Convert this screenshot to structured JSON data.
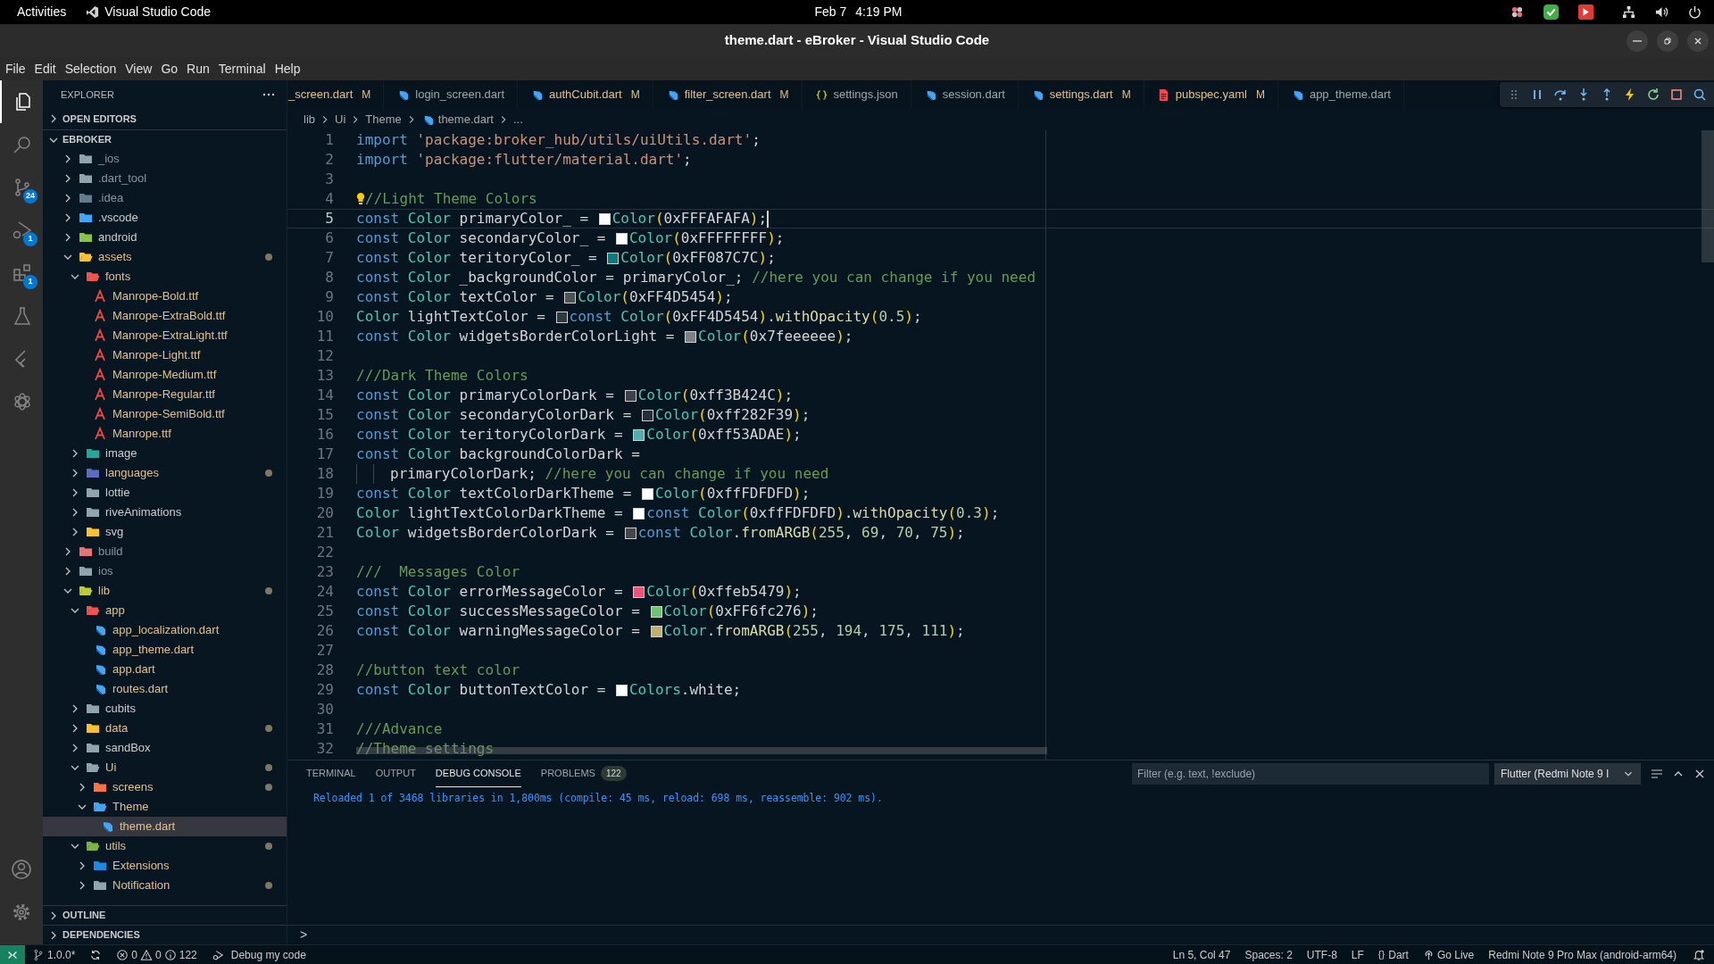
{
  "top_bar": {
    "activities": "Activities",
    "app": "Visual Studio Code",
    "date": "Feb 7",
    "time": "4:19 PM"
  },
  "window": {
    "title": "theme.dart - eBroker - Visual Studio Code"
  },
  "menu": [
    "File",
    "Edit",
    "Selection",
    "View",
    "Go",
    "Run",
    "Terminal",
    "Help"
  ],
  "activity_bar": [
    {
      "kind": "files",
      "selected": true
    },
    {
      "kind": "search",
      "selected": false
    },
    {
      "kind": "source-control",
      "badge": "24",
      "selected": false
    },
    {
      "kind": "run-debug",
      "badge": "1",
      "selected": false
    },
    {
      "kind": "extensions",
      "badge": "1",
      "selected": false
    },
    {
      "kind": "testing",
      "selected": false
    },
    {
      "kind": "flutter",
      "selected": false
    },
    {
      "kind": "knot",
      "selected": false
    }
  ],
  "sidebar": {
    "title": "EXPLORER",
    "sections": [
      {
        "label": "OPEN EDITORS",
        "expanded": false
      },
      {
        "label": "EBROKER",
        "expanded": true,
        "tree": [
          {
            "name": "_ios",
            "kind": "folder",
            "color": "#90a4ae",
            "expanded": false,
            "modified": false,
            "ignored": true,
            "dot": false,
            "selected": false
          },
          {
            "name": ".dart_tool",
            "kind": "folder",
            "color": "#90a4ae",
            "expanded": false,
            "modified": false,
            "ignored": true,
            "dot": false,
            "selected": false
          },
          {
            "name": ".idea",
            "kind": "folder",
            "color": "#607d8b",
            "expanded": false,
            "modified": false,
            "ignored": true,
            "dot": false,
            "selected": false
          },
          {
            "name": ".vscode",
            "kind": "folder",
            "color": "#42a5f5",
            "expanded": false,
            "modified": false,
            "ignored": false,
            "dot": false,
            "selected": false
          },
          {
            "name": "android",
            "kind": "folder",
            "color": "#8bc34a",
            "expanded": false,
            "modified": false,
            "ignored": false,
            "dot": false,
            "selected": false
          },
          {
            "name": "assets",
            "kind": "folder",
            "color": "#fbc02d",
            "expanded": true,
            "modified": true,
            "ignored": false,
            "dot": true,
            "selected": false,
            "children": [
              {
                "name": "fonts",
                "kind": "folder",
                "color": "#ef5350",
                "expanded": true,
                "modified": true,
                "ignored": false,
                "dot": false,
                "selected": false,
                "children": [
                  {
                    "name": "Manrope-Bold.ttf",
                    "kind": "font",
                    "modified": true,
                    "ignored": false,
                    "dot": false,
                    "selected": false
                  },
                  {
                    "name": "Manrope-ExtraBold.ttf",
                    "kind": "font",
                    "modified": true,
                    "ignored": false,
                    "dot": false,
                    "selected": false
                  },
                  {
                    "name": "Manrope-ExtraLight.ttf",
                    "kind": "font",
                    "modified": true,
                    "ignored": false,
                    "dot": false,
                    "selected": false
                  },
                  {
                    "name": "Manrope-Light.ttf",
                    "kind": "font",
                    "modified": true,
                    "ignored": false,
                    "dot": false,
                    "selected": false
                  },
                  {
                    "name": "Manrope-Medium.ttf",
                    "kind": "font",
                    "modified": true,
                    "ignored": false,
                    "dot": false,
                    "selected": false
                  },
                  {
                    "name": "Manrope-Regular.ttf",
                    "kind": "font",
                    "modified": true,
                    "ignored": false,
                    "dot": false,
                    "selected": false
                  },
                  {
                    "name": "Manrope-SemiBold.ttf",
                    "kind": "font",
                    "modified": true,
                    "ignored": false,
                    "dot": false,
                    "selected": false
                  },
                  {
                    "name": "Manrope.ttf",
                    "kind": "font",
                    "modified": true,
                    "ignored": false,
                    "dot": false,
                    "selected": false
                  }
                ]
              },
              {
                "name": "image",
                "kind": "folder",
                "color": "#26a69a",
                "expanded": false,
                "modified": false,
                "ignored": false,
                "dot": false,
                "selected": false
              },
              {
                "name": "languages",
                "kind": "folder",
                "color": "#5c6bc0",
                "expanded": false,
                "modified": true,
                "ignored": false,
                "dot": true,
                "selected": false
              },
              {
                "name": "lottie",
                "kind": "folder",
                "color": "#90a4ae",
                "expanded": false,
                "modified": false,
                "ignored": false,
                "dot": false,
                "selected": false
              },
              {
                "name": "riveAnimations",
                "kind": "folder",
                "color": "#90a4ae",
                "expanded": false,
                "modified": false,
                "ignored": false,
                "dot": false,
                "selected": false
              },
              {
                "name": "svg",
                "kind": "folder",
                "color": "#fbc02d",
                "expanded": false,
                "modified": false,
                "ignored": false,
                "dot": false,
                "selected": false
              }
            ]
          },
          {
            "name": "build",
            "kind": "folder",
            "color": "#e57373",
            "expanded": false,
            "modified": false,
            "ignored": true,
            "dot": false,
            "selected": false
          },
          {
            "name": "ios",
            "kind": "folder",
            "color": "#90a4ae",
            "expanded": false,
            "modified": false,
            "ignored": true,
            "dot": false,
            "selected": false
          },
          {
            "name": "lib",
            "kind": "folder",
            "color": "#c0ca33",
            "expanded": true,
            "modified": true,
            "ignored": false,
            "dot": true,
            "selected": false,
            "children": [
              {
                "name": "app",
                "kind": "folder",
                "color": "#ef5350",
                "expanded": true,
                "modified": true,
                "ignored": false,
                "dot": false,
                "selected": false,
                "children": [
                  {
                    "name": "app_localization.dart",
                    "kind": "dart",
                    "modified": true,
                    "ignored": false,
                    "dot": false,
                    "selected": false
                  },
                  {
                    "name": "app_theme.dart",
                    "kind": "dart",
                    "modified": true,
                    "ignored": false,
                    "dot": false,
                    "selected": false
                  },
                  {
                    "name": "app.dart",
                    "kind": "dart",
                    "modified": true,
                    "ignored": false,
                    "dot": false,
                    "selected": false
                  },
                  {
                    "name": "routes.dart",
                    "kind": "dart",
                    "modified": true,
                    "ignored": false,
                    "dot": false,
                    "selected": false
                  }
                ]
              },
              {
                "name": "cubits",
                "kind": "folder",
                "color": "#90a4ae",
                "expanded": false,
                "modified": false,
                "ignored": false,
                "dot": false,
                "selected": false
              },
              {
                "name": "data",
                "kind": "folder",
                "color": "#fbc02d",
                "expanded": false,
                "modified": true,
                "ignored": false,
                "dot": true,
                "selected": false
              },
              {
                "name": "sandBox",
                "kind": "folder",
                "color": "#90a4ae",
                "expanded": false,
                "modified": false,
                "ignored": false,
                "dot": false,
                "selected": false
              },
              {
                "name": "Ui",
                "kind": "folder",
                "color": "#90a4ae",
                "expanded": true,
                "modified": true,
                "ignored": false,
                "dot": true,
                "selected": false,
                "children": [
                  {
                    "name": "screens",
                    "kind": "folder",
                    "color": "#ff7043",
                    "expanded": false,
                    "modified": true,
                    "ignored": false,
                    "dot": true,
                    "selected": false
                  },
                  {
                    "name": "Theme",
                    "kind": "folder",
                    "color": "#42a5f5",
                    "expanded": true,
                    "modified": true,
                    "ignored": false,
                    "dot": false,
                    "selected": false,
                    "children": [
                      {
                        "name": "theme.dart",
                        "kind": "dart",
                        "modified": true,
                        "ignored": false,
                        "dot": false,
                        "selected": true
                      }
                    ]
                  }
                ]
              },
              {
                "name": "utils",
                "kind": "folder",
                "color": "#7cb342",
                "expanded": true,
                "modified": true,
                "ignored": false,
                "dot": true,
                "selected": false,
                "children": [
                  {
                    "name": "Extensions",
                    "kind": "folder",
                    "color": "#1e88e5",
                    "expanded": false,
                    "modified": true,
                    "ignored": false,
                    "dot": false,
                    "selected": false
                  },
                  {
                    "name": "Notification",
                    "kind": "folder",
                    "color": "#90a4ae",
                    "expanded": false,
                    "modified": true,
                    "ignored": false,
                    "dot": true,
                    "selected": false
                  }
                ]
              }
            ]
          }
        ]
      },
      {
        "label": "OUTLINE",
        "expanded": false
      },
      {
        "label": "DEPENDENCIES",
        "expanded": false
      }
    ]
  },
  "tabs": [
    {
      "label": "_screen.dart",
      "badge": "M",
      "selected": false
    },
    {
      "label": "login_screen.dart",
      "kind": "dart",
      "selected": false
    },
    {
      "label": "authCubit.dart",
      "kind": "dart",
      "badge": "M",
      "selected": false
    },
    {
      "label": "filter_screen.dart",
      "kind": "dart",
      "badge": "M",
      "selected": false
    },
    {
      "label": "settings.json",
      "kind": "json",
      "selected": false
    },
    {
      "label": "session.dart",
      "kind": "dart",
      "selected": false
    },
    {
      "label": "settings.dart",
      "kind": "dart",
      "badge": "M",
      "selected": false
    },
    {
      "label": "pubspec.yaml",
      "kind": "yaml",
      "badge": "M",
      "selected": false
    },
    {
      "label": "app_theme.dart",
      "kind": "dart",
      "selected": false
    }
  ],
  "breadcrumbs": [
    {
      "kind": "folder",
      "text": "lib"
    },
    {
      "kind": "folder",
      "text": "Ui"
    },
    {
      "kind": "folder",
      "text": "Theme"
    },
    {
      "kind": "dart",
      "text": "theme.dart"
    },
    {
      "kind": "more",
      "text": "..."
    }
  ],
  "editor": {
    "lines": [
      {
        "number": "1",
        "current": false,
        "lightbulb": false,
        "continuation": false,
        "tokens": [
          {
            "kind": "keyword",
            "text": "import "
          },
          {
            "kind": "string",
            "text": "'package:broker_hub/utils/uiUtils.dart'"
          },
          {
            "kind": "punct",
            "text": ";"
          }
        ]
      },
      {
        "number": "2",
        "current": false,
        "lightbulb": false,
        "continuation": false,
        "tokens": [
          {
            "kind": "keyword",
            "text": "import "
          },
          {
            "kind": "string",
            "text": "'package:flutter/material.dart'"
          },
          {
            "kind": "punct",
            "text": ";"
          }
        ]
      },
      {
        "number": "3",
        "current": false,
        "lightbulb": false,
        "continuation": false
      },
      {
        "number": "4",
        "current": false,
        "lightbulb": true,
        "continuation": false,
        "tokens": [
          {
            "kind": "comment",
            "text": "//Light Theme Colors"
          }
        ]
      },
      {
        "number": "5",
        "current": true,
        "lightbulb": false,
        "continuation": false,
        "tokens": [
          {
            "kind": "keyword",
            "text": "const "
          },
          {
            "kind": "type",
            "text": "Color "
          },
          {
            "kind": "name",
            "text": "primaryColor_ "
          },
          {
            "kind": "punct",
            "text": "= "
          },
          {
            "kind": "swatch",
            "color": "#fafafa"
          },
          {
            "kind": "type",
            "text": "Color"
          },
          {
            "kind": "bracket",
            "text": "("
          },
          {
            "kind": "name",
            "text": "0xFFFAFAFA"
          },
          {
            "kind": "bracket",
            "text": ")"
          },
          {
            "kind": "punct",
            "text": ";"
          }
        ]
      },
      {
        "number": "6",
        "current": false,
        "lightbulb": false,
        "continuation": false,
        "tokens": [
          {
            "kind": "keyword",
            "text": "const "
          },
          {
            "kind": "type",
            "text": "Color "
          },
          {
            "kind": "name",
            "text": "secondaryColor_ "
          },
          {
            "kind": "punct",
            "text": "= "
          },
          {
            "kind": "swatch",
            "color": "#ffffff"
          },
          {
            "kind": "type",
            "text": "Color"
          },
          {
            "kind": "bracket",
            "text": "("
          },
          {
            "kind": "name",
            "text": "0xFFFFFFFF"
          },
          {
            "kind": "bracket",
            "text": ")"
          },
          {
            "kind": "punct",
            "text": ";"
          }
        ]
      },
      {
        "number": "7",
        "current": false,
        "lightbulb": false,
        "continuation": false,
        "tokens": [
          {
            "kind": "keyword",
            "text": "const "
          },
          {
            "kind": "type",
            "text": "Color "
          },
          {
            "kind": "name",
            "text": "teritoryColor_ "
          },
          {
            "kind": "punct",
            "text": "= "
          },
          {
            "kind": "swatch",
            "color": "#087c7c"
          },
          {
            "kind": "type",
            "text": "Color"
          },
          {
            "kind": "bracket",
            "text": "("
          },
          {
            "kind": "name",
            "text": "0xFF087C7C"
          },
          {
            "kind": "bracket",
            "text": ")"
          },
          {
            "kind": "punct",
            "text": ";"
          }
        ]
      },
      {
        "number": "8",
        "current": false,
        "lightbulb": false,
        "continuation": false,
        "tokens": [
          {
            "kind": "keyword",
            "text": "const "
          },
          {
            "kind": "type",
            "text": "Color "
          },
          {
            "kind": "name",
            "text": "_backgroundColor "
          },
          {
            "kind": "punct",
            "text": "= "
          },
          {
            "kind": "name",
            "text": "primaryColor_"
          },
          {
            "kind": "punct",
            "text": "; "
          },
          {
            "kind": "comment",
            "text": "//here you can change if you need"
          }
        ]
      },
      {
        "number": "9",
        "current": false,
        "lightbulb": false,
        "continuation": false,
        "tokens": [
          {
            "kind": "keyword",
            "text": "const "
          },
          {
            "kind": "type",
            "text": "Color "
          },
          {
            "kind": "name",
            "text": "textColor "
          },
          {
            "kind": "punct",
            "text": "= "
          },
          {
            "kind": "swatch",
            "color": "#4d5454"
          },
          {
            "kind": "type",
            "text": "Color"
          },
          {
            "kind": "bracket",
            "text": "("
          },
          {
            "kind": "name",
            "text": "0xFF4D5454"
          },
          {
            "kind": "bracket",
            "text": ")"
          },
          {
            "kind": "punct",
            "text": ";"
          }
        ]
      },
      {
        "number": "10",
        "current": false,
        "lightbulb": false,
        "continuation": false,
        "tokens": [
          {
            "kind": "type",
            "text": "Color "
          },
          {
            "kind": "name",
            "text": "lightTextColor "
          },
          {
            "kind": "punct",
            "text": "= "
          },
          {
            "kind": "swatch",
            "color": "#2e3a3e"
          },
          {
            "kind": "keyword",
            "text": "const "
          },
          {
            "kind": "type",
            "text": "Color"
          },
          {
            "kind": "bracket",
            "text": "("
          },
          {
            "kind": "name",
            "text": "0xFF4D5454"
          },
          {
            "kind": "bracket",
            "text": ")"
          },
          {
            "kind": "punct",
            "text": "."
          },
          {
            "kind": "method",
            "text": "withOpacity"
          },
          {
            "kind": "bracket",
            "text": "("
          },
          {
            "kind": "number",
            "text": "0.5"
          },
          {
            "kind": "bracket",
            "text": ")"
          },
          {
            "kind": "punct",
            "text": ";"
          }
        ]
      },
      {
        "number": "11",
        "current": false,
        "lightbulb": false,
        "continuation": false,
        "tokens": [
          {
            "kind": "keyword",
            "text": "const "
          },
          {
            "kind": "type",
            "text": "Color "
          },
          {
            "kind": "name",
            "text": "widgetsBorderColorLight "
          },
          {
            "kind": "punct",
            "text": "= "
          },
          {
            "kind": "swatch",
            "color": "#7b8185"
          },
          {
            "kind": "type",
            "text": "Color"
          },
          {
            "kind": "bracket",
            "text": "("
          },
          {
            "kind": "name",
            "text": "0x7feeeeee"
          },
          {
            "kind": "bracket",
            "text": ")"
          },
          {
            "kind": "punct",
            "text": ";"
          }
        ]
      },
      {
        "number": "12",
        "current": false,
        "lightbulb": false,
        "continuation": false
      },
      {
        "number": "13",
        "current": false,
        "lightbulb": false,
        "continuation": false,
        "tokens": [
          {
            "kind": "comment",
            "text": "///Dark Theme Colors"
          }
        ]
      },
      {
        "number": "14",
        "current": false,
        "lightbulb": false,
        "continuation": false,
        "tokens": [
          {
            "kind": "keyword",
            "text": "const "
          },
          {
            "kind": "type",
            "text": "Color "
          },
          {
            "kind": "name",
            "text": "primaryColorDark "
          },
          {
            "kind": "punct",
            "text": "= "
          },
          {
            "kind": "swatch",
            "color": "#3b424c"
          },
          {
            "kind": "type",
            "text": "Color"
          },
          {
            "kind": "bracket",
            "text": "("
          },
          {
            "kind": "name",
            "text": "0xff3B424C"
          },
          {
            "kind": "bracket",
            "text": ")"
          },
          {
            "kind": "punct",
            "text": ";"
          }
        ]
      },
      {
        "number": "15",
        "current": false,
        "lightbulb": false,
        "continuation": false,
        "tokens": [
          {
            "kind": "keyword",
            "text": "const "
          },
          {
            "kind": "type",
            "text": "Color "
          },
          {
            "kind": "name",
            "text": "secondaryColorDark "
          },
          {
            "kind": "punct",
            "text": "= "
          },
          {
            "kind": "swatch",
            "color": "#282f39"
          },
          {
            "kind": "type",
            "text": "Color"
          },
          {
            "kind": "bracket",
            "text": "("
          },
          {
            "kind": "name",
            "text": "0xff282F39"
          },
          {
            "kind": "bracket",
            "text": ")"
          },
          {
            "kind": "punct",
            "text": ";"
          }
        ]
      },
      {
        "number": "16",
        "current": false,
        "lightbulb": false,
        "continuation": false,
        "tokens": [
          {
            "kind": "keyword",
            "text": "const "
          },
          {
            "kind": "type",
            "text": "Color "
          },
          {
            "kind": "name",
            "text": "teritoryColorDark "
          },
          {
            "kind": "punct",
            "text": "= "
          },
          {
            "kind": "swatch",
            "color": "#53adae"
          },
          {
            "kind": "type",
            "text": "Color"
          },
          {
            "kind": "bracket",
            "text": "("
          },
          {
            "kind": "name",
            "text": "0xff53ADAE"
          },
          {
            "kind": "bracket",
            "text": ")"
          },
          {
            "kind": "punct",
            "text": ";"
          }
        ]
      },
      {
        "number": "17",
        "current": false,
        "lightbulb": false,
        "continuation": false,
        "tokens": [
          {
            "kind": "keyword",
            "text": "const "
          },
          {
            "kind": "type",
            "text": "Color "
          },
          {
            "kind": "name",
            "text": "backgroundColorDark "
          },
          {
            "kind": "punct",
            "text": "="
          }
        ]
      },
      {
        "number": "18",
        "current": false,
        "lightbulb": false,
        "continuation": true,
        "tokens": [
          {
            "kind": "name",
            "text": "primaryColorDark"
          },
          {
            "kind": "punct",
            "text": "; "
          },
          {
            "kind": "comment",
            "text": "//here you can change if you need"
          }
        ]
      },
      {
        "number": "19",
        "current": false,
        "lightbulb": false,
        "continuation": false,
        "tokens": [
          {
            "kind": "keyword",
            "text": "const "
          },
          {
            "kind": "type",
            "text": "Color "
          },
          {
            "kind": "name",
            "text": "textColorDarkTheme "
          },
          {
            "kind": "punct",
            "text": "= "
          },
          {
            "kind": "swatch",
            "color": "#fdfdfd"
          },
          {
            "kind": "type",
            "text": "Color"
          },
          {
            "kind": "bracket",
            "text": "("
          },
          {
            "kind": "name",
            "text": "0xffFDFDFD"
          },
          {
            "kind": "bracket",
            "text": ")"
          },
          {
            "kind": "punct",
            "text": ";"
          }
        ]
      },
      {
        "number": "20",
        "current": false,
        "lightbulb": false,
        "continuation": false,
        "tokens": [
          {
            "kind": "type",
            "text": "Color "
          },
          {
            "kind": "name",
            "text": "lightTextColorDarkTheme "
          },
          {
            "kind": "punct",
            "text": "= "
          },
          {
            "kind": "swatch",
            "color": "#fdfdfd"
          },
          {
            "kind": "keyword",
            "text": "const "
          },
          {
            "kind": "type",
            "text": "Color"
          },
          {
            "kind": "bracket",
            "text": "("
          },
          {
            "kind": "name",
            "text": "0xffFDFDFD"
          },
          {
            "kind": "bracket",
            "text": ")"
          },
          {
            "kind": "punct",
            "text": "."
          },
          {
            "kind": "method",
            "text": "withOpacity"
          },
          {
            "kind": "bracket",
            "text": "("
          },
          {
            "kind": "number",
            "text": "0.3"
          },
          {
            "kind": "bracket",
            "text": ")"
          },
          {
            "kind": "punct",
            "text": ";"
          }
        ]
      },
      {
        "number": "21",
        "current": false,
        "lightbulb": false,
        "continuation": false,
        "tokens": [
          {
            "kind": "type",
            "text": "Color "
          },
          {
            "kind": "name",
            "text": "widgetsBorderColorDark "
          },
          {
            "kind": "punct",
            "text": "= "
          },
          {
            "kind": "swatch",
            "color": "#45464b"
          },
          {
            "kind": "keyword",
            "text": "const "
          },
          {
            "kind": "type",
            "text": "Color"
          },
          {
            "kind": "punct",
            "text": "."
          },
          {
            "kind": "method",
            "text": "fromARGB"
          },
          {
            "kind": "bracket",
            "text": "("
          },
          {
            "kind": "number",
            "text": "255"
          },
          {
            "kind": "punct",
            "text": ", "
          },
          {
            "kind": "number",
            "text": "69"
          },
          {
            "kind": "punct",
            "text": ", "
          },
          {
            "kind": "number",
            "text": "70"
          },
          {
            "kind": "punct",
            "text": ", "
          },
          {
            "kind": "number",
            "text": "75"
          },
          {
            "kind": "bracket",
            "text": ")"
          },
          {
            "kind": "punct",
            "text": ";"
          }
        ]
      },
      {
        "number": "22",
        "current": false,
        "lightbulb": false,
        "continuation": false
      },
      {
        "number": "23",
        "current": false,
        "lightbulb": false,
        "continuation": false,
        "tokens": [
          {
            "kind": "comment",
            "text": "///  Messages Color"
          }
        ]
      },
      {
        "number": "24",
        "current": false,
        "lightbulb": false,
        "continuation": false,
        "tokens": [
          {
            "kind": "keyword",
            "text": "const "
          },
          {
            "kind": "type",
            "text": "Color "
          },
          {
            "kind": "name",
            "text": "errorMessageColor "
          },
          {
            "kind": "punct",
            "text": "= "
          },
          {
            "kind": "swatch",
            "color": "#eb5479"
          },
          {
            "kind": "type",
            "text": "Color"
          },
          {
            "kind": "bracket",
            "text": "("
          },
          {
            "kind": "name",
            "text": "0xffeb5479"
          },
          {
            "kind": "bracket",
            "text": ")"
          },
          {
            "kind": "punct",
            "text": ";"
          }
        ]
      },
      {
        "number": "25",
        "current": false,
        "lightbulb": false,
        "continuation": false,
        "tokens": [
          {
            "kind": "keyword",
            "text": "const "
          },
          {
            "kind": "type",
            "text": "Color "
          },
          {
            "kind": "name",
            "text": "successMessageColor "
          },
          {
            "kind": "punct",
            "text": "= "
          },
          {
            "kind": "swatch",
            "color": "#6fc276"
          },
          {
            "kind": "type",
            "text": "Color"
          },
          {
            "kind": "bracket",
            "text": "("
          },
          {
            "kind": "name",
            "text": "0xFF6fc276"
          },
          {
            "kind": "bracket",
            "text": ")"
          },
          {
            "kind": "punct",
            "text": ";"
          }
        ]
      },
      {
        "number": "26",
        "current": false,
        "lightbulb": false,
        "continuation": false,
        "tokens": [
          {
            "kind": "keyword",
            "text": "const "
          },
          {
            "kind": "type",
            "text": "Color "
          },
          {
            "kind": "name",
            "text": "warningMessageColor "
          },
          {
            "kind": "punct",
            "text": "= "
          },
          {
            "kind": "swatch",
            "color": "#c2af6f"
          },
          {
            "kind": "type",
            "text": "Color"
          },
          {
            "kind": "punct",
            "text": "."
          },
          {
            "kind": "method",
            "text": "fromARGB"
          },
          {
            "kind": "bracket",
            "text": "("
          },
          {
            "kind": "number",
            "text": "255"
          },
          {
            "kind": "punct",
            "text": ", "
          },
          {
            "kind": "number",
            "text": "194"
          },
          {
            "kind": "punct",
            "text": ", "
          },
          {
            "kind": "number",
            "text": "175"
          },
          {
            "kind": "punct",
            "text": ", "
          },
          {
            "kind": "number",
            "text": "111"
          },
          {
            "kind": "bracket",
            "text": ")"
          },
          {
            "kind": "punct",
            "text": ";"
          }
        ]
      },
      {
        "number": "27",
        "current": false,
        "lightbulb": false,
        "continuation": false
      },
      {
        "number": "28",
        "current": false,
        "lightbulb": false,
        "continuation": false,
        "tokens": [
          {
            "kind": "comment",
            "text": "//button text color"
          }
        ]
      },
      {
        "number": "29",
        "current": false,
        "lightbulb": false,
        "continuation": false,
        "tokens": [
          {
            "kind": "keyword",
            "text": "const "
          },
          {
            "kind": "type",
            "text": "Color "
          },
          {
            "kind": "name",
            "text": "buttonTextColor "
          },
          {
            "kind": "punct",
            "text": "= "
          },
          {
            "kind": "swatch",
            "color": "#ffffff"
          },
          {
            "kind": "type",
            "text": "Colors"
          },
          {
            "kind": "punct",
            "text": "."
          },
          {
            "kind": "name",
            "text": "white"
          },
          {
            "kind": "punct",
            "text": ";"
          }
        ]
      },
      {
        "number": "30",
        "current": false,
        "lightbulb": false,
        "continuation": false
      },
      {
        "number": "31",
        "current": false,
        "lightbulb": false,
        "continuation": false,
        "tokens": [
          {
            "kind": "comment",
            "text": "///Advance"
          }
        ]
      },
      {
        "number": "32",
        "current": false,
        "lightbulb": false,
        "continuation": false,
        "tokens": [
          {
            "kind": "comment",
            "text": "//Theme settings"
          }
        ]
      }
    ]
  },
  "panel": {
    "tabs": [
      {
        "label": "TERMINAL",
        "selected": false
      },
      {
        "label": "OUTPUT",
        "selected": false
      },
      {
        "label": "DEBUG CONSOLE",
        "selected": true
      },
      {
        "label": "PROBLEMS",
        "badge": "122",
        "selected": false
      }
    ],
    "filter": {
      "placeholder": "Filter (e.g. text, !exclude)"
    },
    "session": "Flutter (Redmi Note 9 I",
    "output": [
      "Reloaded 1 of 3468 libraries in 1,800ms (compile: 45 ms, reload: 698 ms, reassemble: 902 ms)."
    ],
    "prompt": ">"
  },
  "status_bar": {
    "branch": "1.0.0*",
    "errors": "0",
    "warnings": "0",
    "infos": "122",
    "launch": "Debug my code",
    "right": [
      {
        "kind": "text",
        "text": "Ln 5, Col 47"
      },
      {
        "kind": "text",
        "text": "Spaces: 2"
      },
      {
        "kind": "text",
        "text": "UTF-8"
      },
      {
        "kind": "text",
        "text": "LF"
      },
      {
        "kind": "language",
        "glyph": "{}",
        "text": "Dart"
      },
      {
        "kind": "live",
        "text": "Go Live"
      },
      {
        "kind": "text",
        "text": "Redmi Note 9 Pro Max (android-arm64)"
      }
    ]
  }
}
